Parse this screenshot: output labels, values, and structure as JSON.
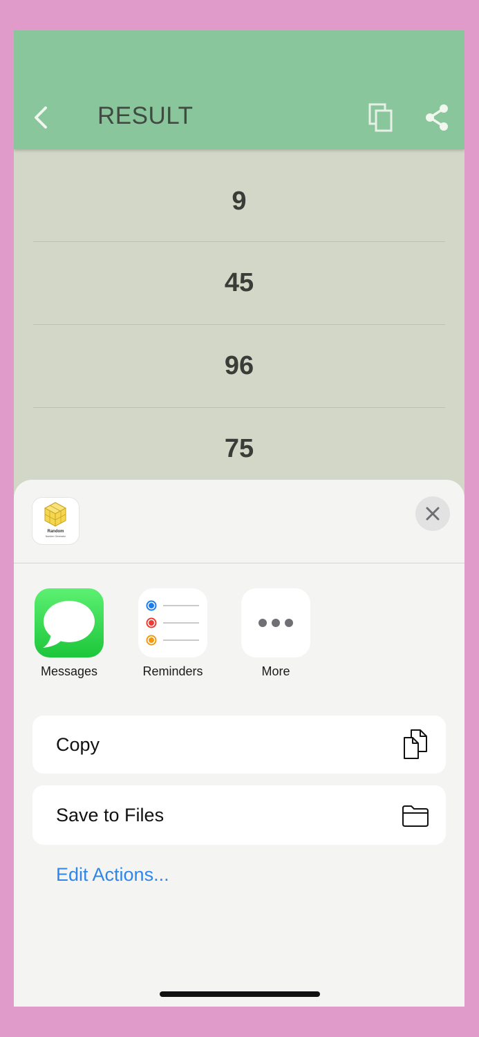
{
  "header": {
    "title": "RESULT"
  },
  "results": [
    "9",
    "45",
    "96",
    "75"
  ],
  "share_sheet": {
    "app_icon": {
      "line1": "Random",
      "line2": "Number Generator"
    },
    "targets": [
      {
        "label": "Messages",
        "icon": "messages-icon"
      },
      {
        "label": "Reminders",
        "icon": "reminders-icon"
      },
      {
        "label": "More",
        "icon": "more-icon"
      }
    ],
    "actions": [
      {
        "label": "Copy",
        "icon": "copy-icon"
      },
      {
        "label": "Save to Files",
        "icon": "folder-icon"
      }
    ],
    "edit_actions": "Edit Actions..."
  },
  "colors": {
    "background": "#e19bcb",
    "header": "#89c69b",
    "results_bg": "#d2d7c8",
    "sheet": "#f4f4f3",
    "link": "#2e86e8"
  }
}
